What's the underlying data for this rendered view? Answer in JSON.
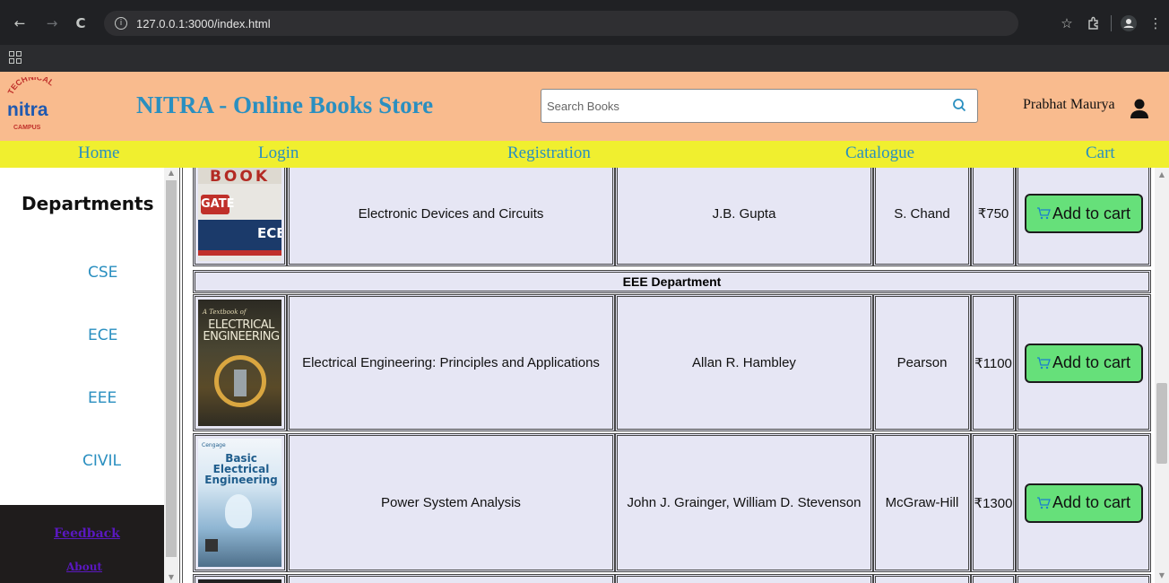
{
  "browser": {
    "url": "127.0.0.1:3000/index.html",
    "back_icon": "←",
    "forward_icon": "→",
    "reload_icon": "C",
    "star_icon": "☆",
    "menu_icon": "⋮"
  },
  "header": {
    "logo_text_top": "TECHNICAL",
    "logo_text_main": "nitra",
    "logo_text_bottom": "CAMPUS",
    "title": "NITRA - Online Books Store",
    "search_placeholder": "Search Books",
    "user_name": "Prabhat Maurya"
  },
  "nav": {
    "items": [
      "Home",
      "Login",
      "Registration",
      "Catalogue",
      "Cart"
    ]
  },
  "sidebar": {
    "title": "Departments",
    "departments": [
      "CSE",
      "ECE",
      "EEE",
      "CIVIL"
    ],
    "footer_links": [
      "Feedback",
      "About"
    ]
  },
  "table": {
    "add_label": "Add to cart",
    "eee_heading": "EEE Department",
    "rows": [
      {
        "title": "Electronic Devices and Circuits",
        "author": "J.B. Gupta",
        "publisher": "S. Chand",
        "price": "₹750"
      },
      {
        "title": "Electrical Engineering: Principles and Applications",
        "author": "Allan R. Hambley",
        "publisher": "Pearson",
        "price": "₹1100"
      },
      {
        "title": "Power System Analysis",
        "author": "John J. Grainger, William D. Stevenson",
        "publisher": "McGraw-Hill",
        "price": "₹1300"
      }
    ],
    "covers": [
      {
        "top": "BOOK",
        "badge": "GATE",
        "sub": "ECE"
      },
      {
        "top": "A Textbook of",
        "main": "ELECTRICAL ENGINEERING"
      },
      {
        "brand": "Cengage",
        "main": "Basic Electrical Engineering"
      }
    ]
  },
  "colors": {
    "header_bg": "#f9bb8e",
    "nav_bg": "#f0ef2f",
    "link_blue": "#2a8fc0",
    "button_green": "#66e07a",
    "cell_bg": "#e6e6f4"
  }
}
